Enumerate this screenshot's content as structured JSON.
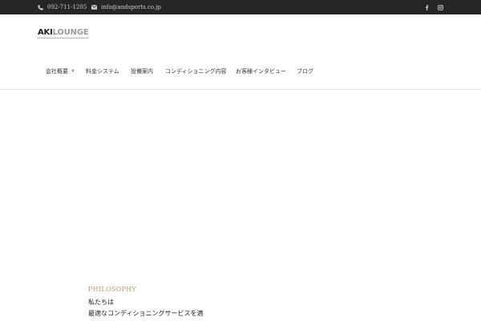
{
  "topbar": {
    "phone": "092-711-1205",
    "email": "info@andsports.co.jp",
    "icons": [
      "phone-icon",
      "mail-icon",
      "facebook-icon",
      "instagram-icon"
    ]
  },
  "logo": {
    "part1": "AKI",
    "part2": "LOUNGE",
    "sub": "CONDITIONING"
  },
  "nav": {
    "items": [
      {
        "label": "会社概要",
        "has_dropdown": true
      },
      {
        "label": "料金システム"
      },
      {
        "label": "設備案内"
      },
      {
        "label": "コンディショニング内容"
      },
      {
        "label": "お客様インタビュー"
      },
      {
        "label": "ブログ"
      }
    ]
  },
  "philosophy": {
    "label": "PHILOSOPHY",
    "line1": "私たちは",
    "line2": "最適なコンディショニングサービスを適"
  },
  "colors": {
    "topbar_bg": "#262626",
    "accent": "#b89a6a"
  }
}
